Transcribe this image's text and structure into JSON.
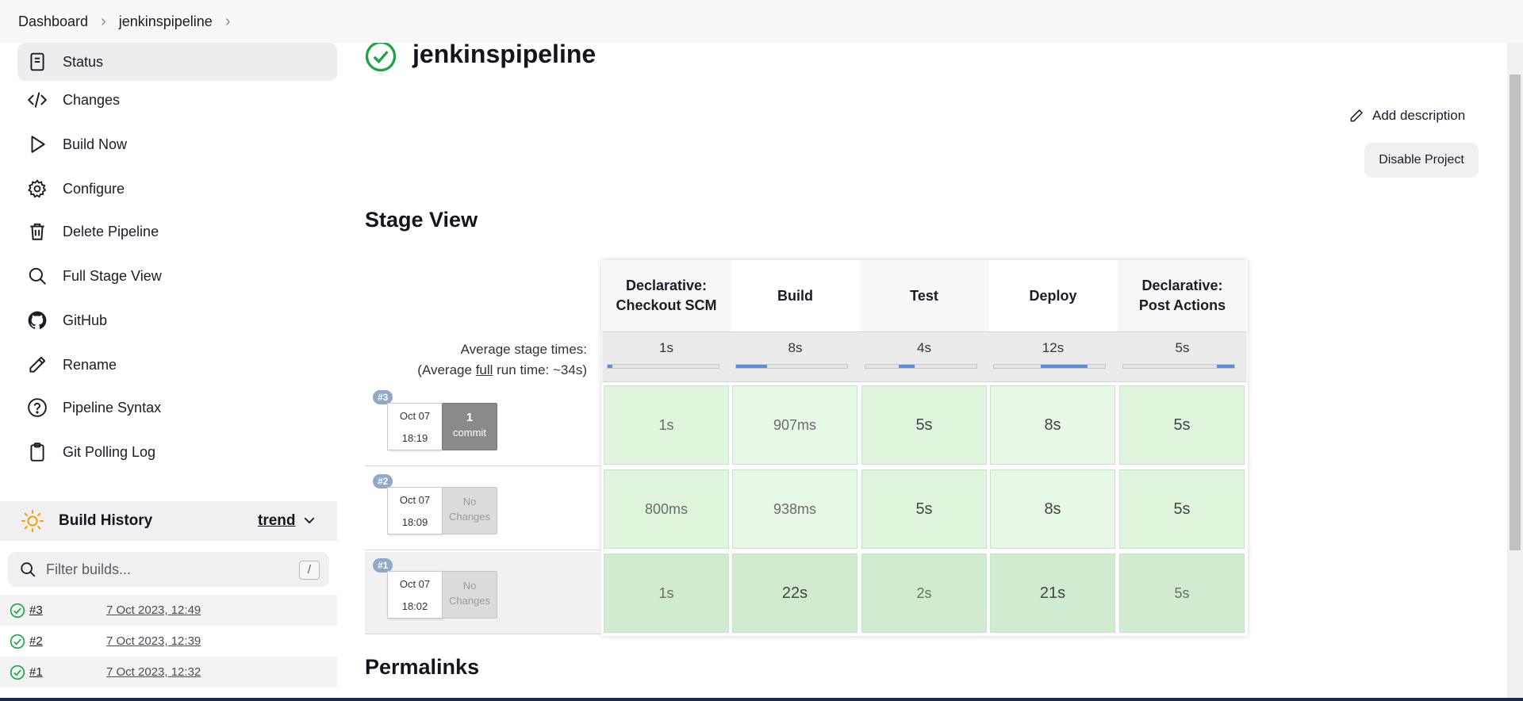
{
  "breadcrumb": {
    "items": [
      "Dashboard",
      "jenkinspipeline"
    ]
  },
  "sidebar": {
    "tasks": [
      {
        "label": "Status",
        "icon": "document-icon",
        "active": true
      },
      {
        "label": "Changes",
        "icon": "code-icon"
      },
      {
        "label": "Build Now",
        "icon": "play-icon"
      },
      {
        "label": "Configure",
        "icon": "gear-icon"
      },
      {
        "label": "Delete Pipeline",
        "icon": "trash-icon"
      },
      {
        "label": "Full Stage View",
        "icon": "search-icon"
      },
      {
        "label": "GitHub",
        "icon": "github-icon"
      },
      {
        "label": "Rename",
        "icon": "pencil-icon"
      },
      {
        "label": "Pipeline Syntax",
        "icon": "help-icon"
      },
      {
        "label": "Git Polling Log",
        "icon": "clipboard-icon"
      }
    ],
    "build_history": {
      "title": "Build History",
      "trend_label": "trend",
      "filter_placeholder": "Filter builds...",
      "filter_shortcut": "/",
      "builds": [
        {
          "num": "#3",
          "date": "7 Oct 2023, 12:49"
        },
        {
          "num": "#2",
          "date": "7 Oct 2023, 12:39"
        },
        {
          "num": "#1",
          "date": "7 Oct 2023, 12:32"
        }
      ]
    }
  },
  "main": {
    "title": "jenkinspipeline",
    "add_description": "Add description",
    "disable_project": "Disable Project",
    "stage_view_title": "Stage View",
    "permalinks_title": "Permalinks"
  },
  "stage_view": {
    "avg_label_line1": "Average stage times:",
    "avg_label_prefix": "(Average ",
    "avg_label_link": "full",
    "avg_label_suffix": " run time: ~34s)",
    "stages": [
      {
        "name_line1": "Declarative:",
        "name_line2": "Checkout SCM",
        "avg": "1s",
        "avg_fill_start": 0.0,
        "avg_fill_end": 0.04
      },
      {
        "name_line1": "Build",
        "name_line2": "",
        "avg": "8s",
        "avg_fill_start": 0.0,
        "avg_fill_end": 0.28
      },
      {
        "name_line1": "Test",
        "name_line2": "",
        "avg": "4s",
        "avg_fill_start": 0.3,
        "avg_fill_end": 0.44
      },
      {
        "name_line1": "Deploy",
        "name_line2": "",
        "avg": "12s",
        "avg_fill_start": 0.42,
        "avg_fill_end": 0.84
      },
      {
        "name_line1": "Declarative:",
        "name_line2": "Post Actions",
        "avg": "5s",
        "avg_fill_start": 0.84,
        "avg_fill_end": 1.0
      }
    ],
    "runs": [
      {
        "badge": "#3",
        "date": "Oct 07",
        "time": "18:19",
        "commit_line1": "1",
        "commit_line2": "commit",
        "has_commit": true,
        "durations": [
          "1s",
          "907ms",
          "5s",
          "8s",
          "5s"
        ]
      },
      {
        "badge": "#2",
        "date": "Oct 07",
        "time": "18:09",
        "commit_line1": "No",
        "commit_line2": "Changes",
        "has_commit": false,
        "durations": [
          "800ms",
          "938ms",
          "5s",
          "8s",
          "5s"
        ]
      },
      {
        "badge": "#1",
        "date": "Oct 07",
        "time": "18:02",
        "commit_line1": "No",
        "commit_line2": "Changes",
        "has_commit": false,
        "durations": [
          "1s",
          "22s",
          "2s",
          "21s",
          "5s"
        ]
      }
    ]
  },
  "colors": {
    "success": "#1ea446",
    "avg_bar": "#5b8fd7",
    "cell_green": "#dff5de",
    "badge": "#8fa9c8"
  }
}
